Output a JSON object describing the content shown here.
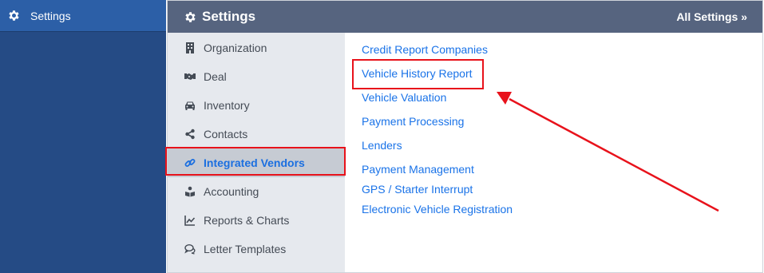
{
  "left_nav": {
    "item_label": "Settings"
  },
  "header": {
    "title": "Settings",
    "all_settings": "All Settings »"
  },
  "categories": [
    {
      "label": "Organization",
      "icon": "building-icon"
    },
    {
      "label": "Deal",
      "icon": "handshake-icon"
    },
    {
      "label": "Inventory",
      "icon": "car-icon"
    },
    {
      "label": "Contacts",
      "icon": "share-icon"
    },
    {
      "label": "Integrated Vendors",
      "icon": "link-icon",
      "active": true
    },
    {
      "label": "Accounting",
      "icon": "book-reader-icon"
    },
    {
      "label": "Reports & Charts",
      "icon": "line-chart-icon"
    },
    {
      "label": "Letter Templates",
      "icon": "comments-icon"
    }
  ],
  "vendors": [
    "Credit Report Companies",
    "Vehicle History Report",
    "Vehicle Valuation",
    "Payment Processing",
    "Lenders",
    "Payment Management",
    "GPS / Starter Interrupt",
    "Electronic Vehicle Registration"
  ],
  "colors": {
    "left_nav_bg": "#254b85",
    "header_bg": "#56647f",
    "link": "#1a73e8",
    "annotation": "#e8121b"
  }
}
